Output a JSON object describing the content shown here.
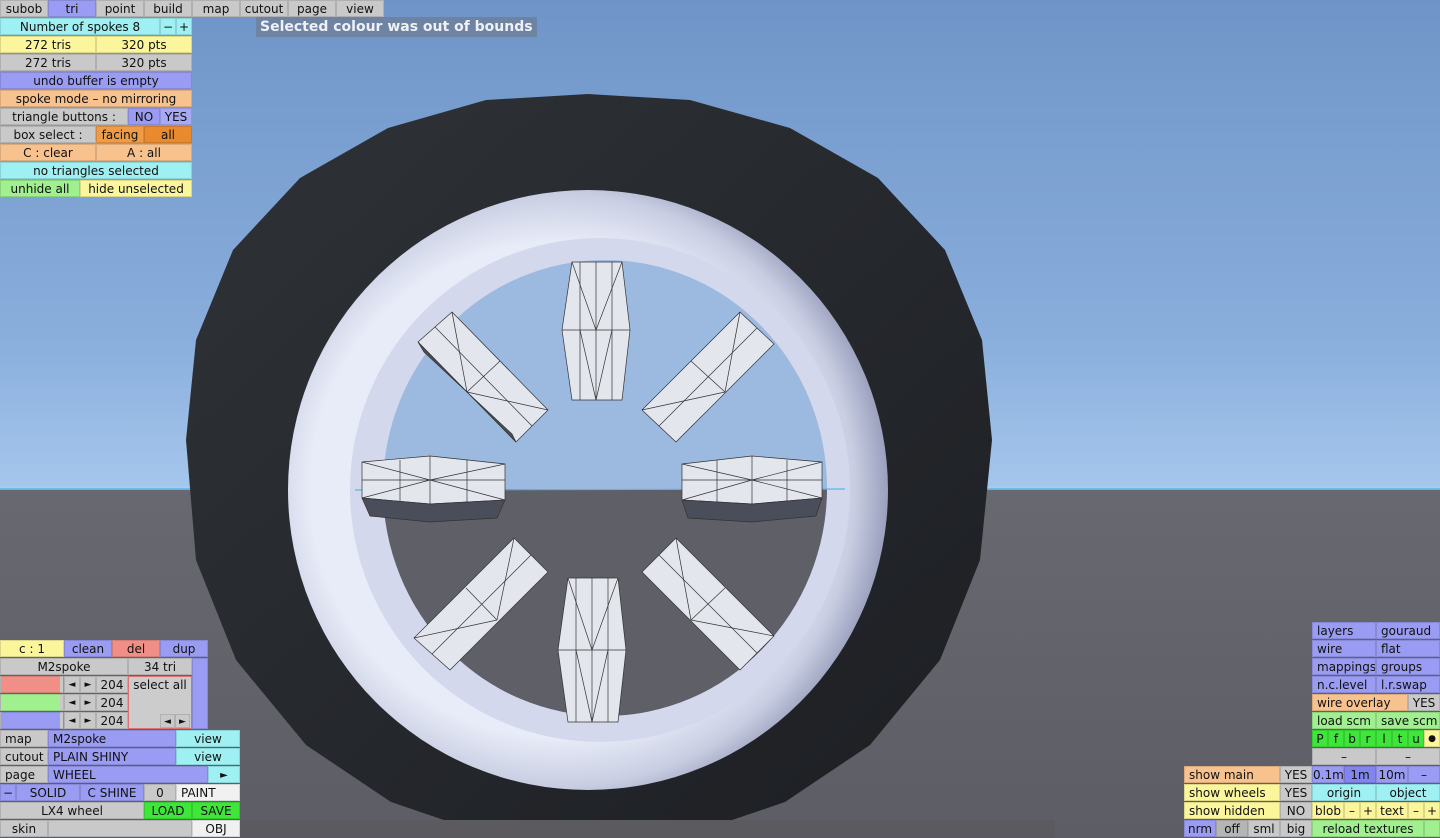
{
  "menu": [
    "subob",
    "tri",
    "point",
    "build",
    "map",
    "cutout",
    "page",
    "view"
  ],
  "message": "Selected colour was out of bounds",
  "spokes": {
    "label": "Number of spokes 8",
    "minus": "−",
    "plus": "+"
  },
  "counts": {
    "tris1": "272 tris",
    "pts1": "320 pts",
    "tris2": "272 tris",
    "pts2": "320 pts"
  },
  "undo": "undo buffer is empty",
  "spoke_mode": "spoke mode – no mirroring",
  "tri_buttons": {
    "label": "triangle buttons :",
    "no": "NO",
    "yes": "YES"
  },
  "box_select": {
    "label": "box select :",
    "facing": "facing",
    "all": "all"
  },
  "clear": {
    "c": "C : clear",
    "a": "A : all"
  },
  "no_tri": "no triangles selected",
  "unhide": {
    "unhide_all": "unhide all",
    "hide_unselected": "hide unselected"
  },
  "bottom_left": {
    "c1": "c : 1",
    "clean": "clean",
    "del": "del",
    "dup": "dup",
    "name": "M2spoke",
    "tri_count": "34 tri",
    "rgb": [
      "204",
      "204",
      "204"
    ],
    "select_all": "select all",
    "map_label": "map",
    "map_value": "M2spoke",
    "map_view": "view",
    "cutout_label": "cutout",
    "cutout_value": "PLAIN SHINY",
    "cutout_view": "view",
    "page_label": "page",
    "page_value": "WHEEL",
    "page_arrow": "►",
    "minus": "−",
    "solid": "SOLID",
    "cshine": "C SHINE",
    "zero": "0",
    "paint": "PAINT",
    "object_name": "LX4 wheel",
    "load": "LOAD",
    "save": "SAVE",
    "skin": "skin",
    "obj": "OBJ"
  },
  "bottom_right": {
    "layers": "layers",
    "gouraud": "gouraud",
    "wire": "wire",
    "flat": "flat",
    "mappings": "mappings",
    "groups": "groups",
    "nclevel": "n.c.level",
    "lrswap": "l.r.swap",
    "wire_overlay": "wire overlay",
    "wire_overlay_val": "YES",
    "load_scm": "load scm",
    "save_scm": "save scm",
    "letters": [
      "P",
      "f",
      "b",
      "r",
      "l",
      "t",
      "u",
      "●"
    ],
    "dash": "–",
    "show_main": "show main",
    "show_main_val": "YES",
    "show_wheels": "show wheels",
    "show_wheels_val": "YES",
    "show_hidden": "show hidden",
    "show_hidden_val": "NO",
    "scale": [
      "0.1m",
      "1m",
      "10m",
      "–"
    ],
    "origin": "origin",
    "object": "object",
    "blob": "blob",
    "text": "text",
    "nrm": "nrm",
    "off": "off",
    "sml": "sml",
    "big": "big",
    "reload": "reload textures"
  }
}
